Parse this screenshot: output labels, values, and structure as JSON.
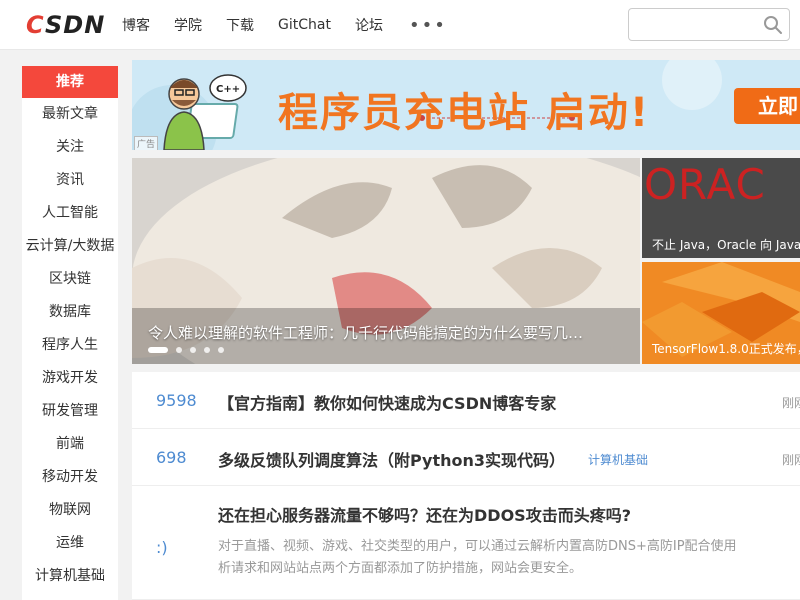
{
  "header": {
    "logo_text": "CSDN",
    "nav": [
      "博客",
      "学院",
      "下载",
      "GitChat",
      "论坛"
    ],
    "more": "•••",
    "search_placeholder": ""
  },
  "sidebar": {
    "items": [
      "推荐",
      "最新文章",
      "关注",
      "资讯",
      "人工智能",
      "云计算/大数据",
      "区块链",
      "数据库",
      "程序人生",
      "游戏开发",
      "研发管理",
      "前端",
      "移动开发",
      "物联网",
      "运维",
      "计算机基础"
    ],
    "active_index": 0
  },
  "banner": {
    "headline": "程序员充电站 启动!",
    "cta": "立即",
    "ad_label": "广告",
    "bubble_text": "C++",
    "colors": {
      "bg": "#cfe9f6",
      "headline": "#f17520",
      "cta": "#f06b16"
    }
  },
  "carousel": {
    "caption": "令人难以理解的软件工程师：几千行代码能搞定的为什么要写几…",
    "slide_count": 5,
    "active_slide": 0
  },
  "tiles": [
    {
      "brand": "ORAC",
      "caption": "不止 Java，Oracle 向 Java"
    },
    {
      "caption": "TensorFlow1.8.0正式发布，"
    }
  ],
  "feed": [
    {
      "count": "9598",
      "title": "【官方指南】教你如何快速成为CSDN博客专家",
      "tag": "",
      "time": "刚刚"
    },
    {
      "count": "698",
      "title": "多级反馈队列调度算法（附Python3实现代码）",
      "tag": "计算机基础",
      "time": "刚刚"
    },
    {
      "count": ":)",
      "title": "还在担心服务器流量不够吗？还在为DDOS攻击而头疼吗?",
      "tag": "",
      "time": "",
      "summary": [
        "对于直播、视频、游戏、社交类型的用户，可以通过云解析内置高防DNS+高防IP配合使用",
        "析请求和网站站点两个方面都添加了防护措施，网站会更安全。"
      ]
    }
  ],
  "colors": {
    "accent": "#f4483c",
    "link": "#4e8bd1"
  }
}
